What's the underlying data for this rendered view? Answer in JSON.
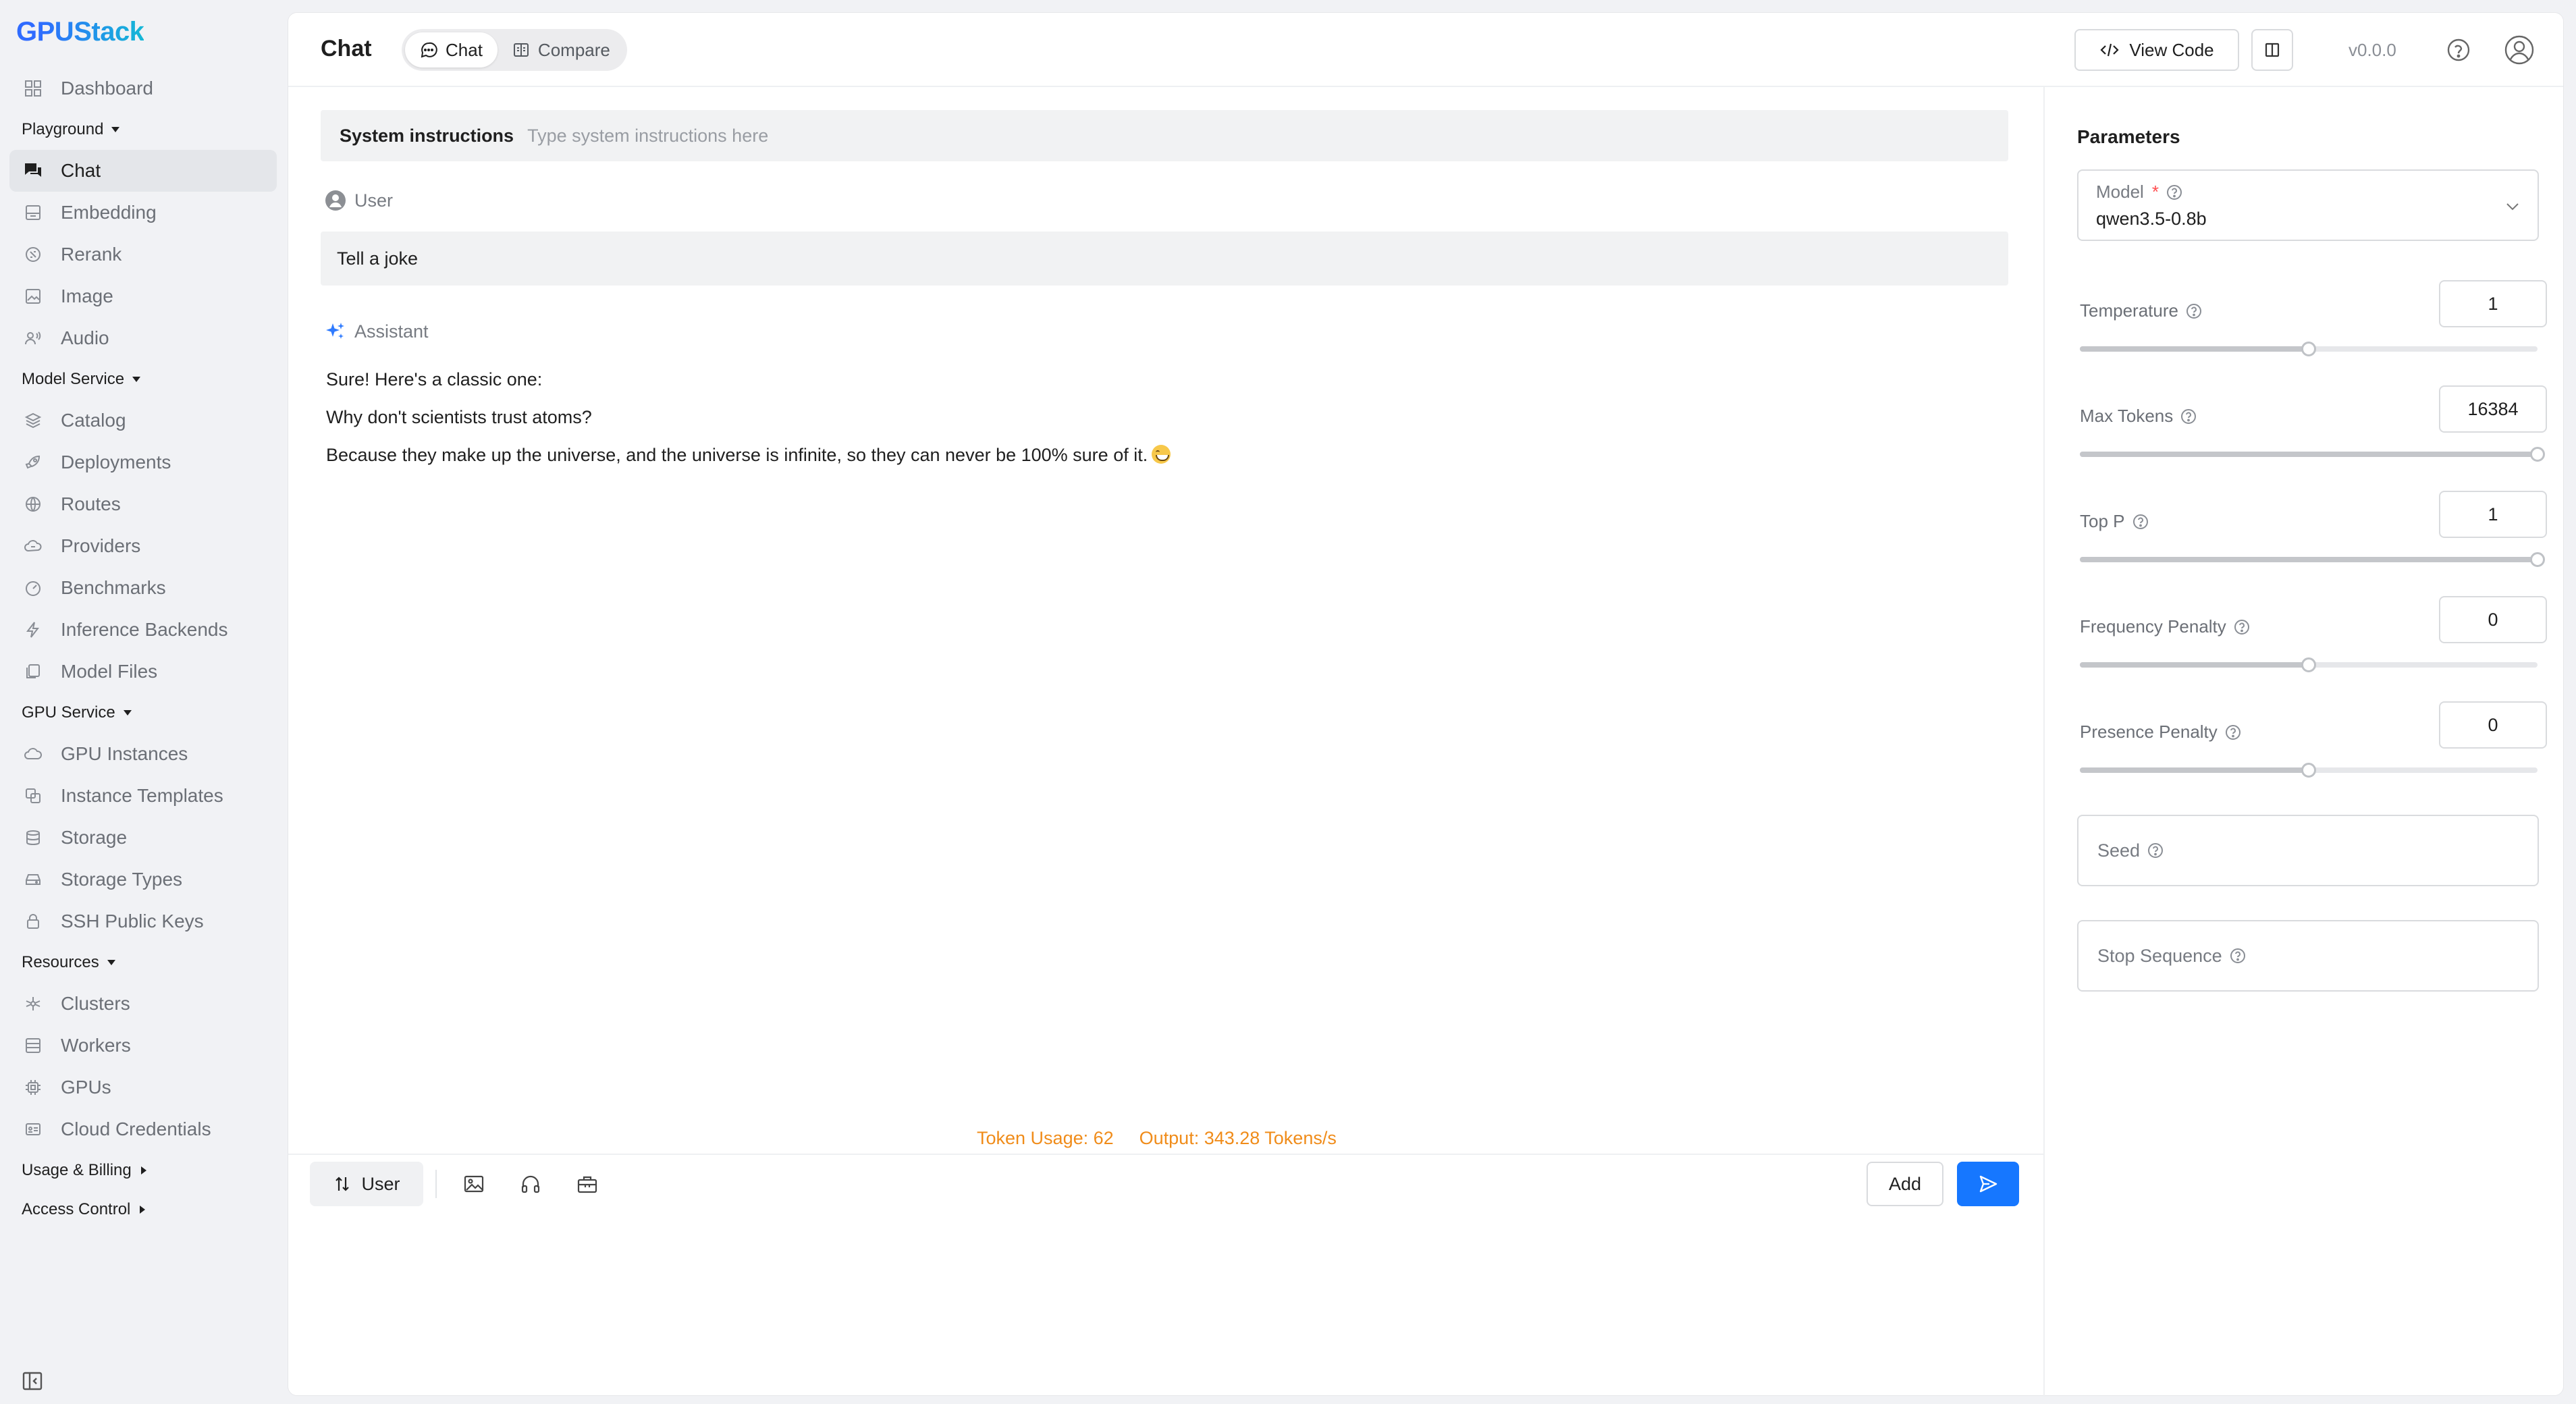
{
  "app": {
    "logo_first": "G",
    "logo_rest": "PUStack"
  },
  "sidebar": {
    "top_items": [
      {
        "label": "Dashboard",
        "icon": "dashboard-icon"
      }
    ],
    "groups": [
      {
        "label": "Playground",
        "expanded": true,
        "items": [
          {
            "label": "Chat",
            "icon": "chat-icon",
            "active": true
          },
          {
            "label": "Embedding",
            "icon": "embedding-icon"
          },
          {
            "label": "Rerank",
            "icon": "rerank-icon"
          },
          {
            "label": "Image",
            "icon": "image-icon"
          },
          {
            "label": "Audio",
            "icon": "audio-icon"
          }
        ]
      },
      {
        "label": "Model Service",
        "expanded": true,
        "items": [
          {
            "label": "Catalog",
            "icon": "catalog-icon"
          },
          {
            "label": "Deployments",
            "icon": "rocket-icon"
          },
          {
            "label": "Routes",
            "icon": "routes-icon"
          },
          {
            "label": "Providers",
            "icon": "providers-icon"
          },
          {
            "label": "Benchmarks",
            "icon": "gauge-icon"
          },
          {
            "label": "Inference Backends",
            "icon": "bolt-icon"
          },
          {
            "label": "Model Files",
            "icon": "files-icon"
          }
        ]
      },
      {
        "label": "GPU Service",
        "expanded": true,
        "items": [
          {
            "label": "GPU Instances",
            "icon": "cloud-icon"
          },
          {
            "label": "Instance Templates",
            "icon": "template-icon"
          },
          {
            "label": "Storage",
            "icon": "database-icon"
          },
          {
            "label": "Storage Types",
            "icon": "drive-icon"
          },
          {
            "label": "SSH Public Keys",
            "icon": "lock-icon"
          }
        ]
      },
      {
        "label": "Resources",
        "expanded": true,
        "items": [
          {
            "label": "Clusters",
            "icon": "cluster-icon"
          },
          {
            "label": "Workers",
            "icon": "server-icon"
          },
          {
            "label": "GPUs",
            "icon": "chip-icon"
          },
          {
            "label": "Cloud Credentials",
            "icon": "credential-icon"
          }
        ]
      },
      {
        "label": "Usage & Billing",
        "expanded": false,
        "items": []
      },
      {
        "label": "Access Control",
        "expanded": false,
        "items": []
      }
    ]
  },
  "header": {
    "title": "Chat",
    "tabs": [
      {
        "label": "Chat",
        "icon": "chat-bubble-icon",
        "active": true
      },
      {
        "label": "Compare",
        "icon": "compare-icon",
        "active": false
      }
    ],
    "view_code_label": "View Code",
    "version": "v0.0.0"
  },
  "chat": {
    "system_label": "System instructions",
    "system_placeholder": "Type system instructions here",
    "user_role": "User",
    "user_message": "Tell a joke",
    "assistant_role": "Assistant",
    "assistant_lines": [
      "Sure! Here's a classic one:",
      "Why don't scientists trust atoms?",
      "Because they make up the universe, and the universe is infinite, so they can never be 100% sure of it."
    ],
    "token_usage": "Token Usage: 62",
    "output_rate": "Output: 343.28 Tokens/s"
  },
  "composer": {
    "role_label": "User",
    "add_label": "Add"
  },
  "parameters": {
    "title": "Parameters",
    "model_label": "Model",
    "model_value": "qwen3.5-0.8b",
    "sliders": [
      {
        "label": "Temperature",
        "value": "1",
        "fraction": 0.5
      },
      {
        "label": "Max Tokens",
        "value": "16384",
        "fraction": 1.0
      },
      {
        "label": "Top P",
        "value": "1",
        "fraction": 1.0
      },
      {
        "label": "Frequency Penalty",
        "value": "0",
        "fraction": 0.5
      },
      {
        "label": "Presence Penalty",
        "value": "0",
        "fraction": 0.5
      }
    ],
    "seed_label": "Seed",
    "stop_sequence_label": "Stop Sequence"
  },
  "colors": {
    "accent": "#1677ff",
    "token_usage": "#f08c1a",
    "required": "#ff4d4f"
  }
}
